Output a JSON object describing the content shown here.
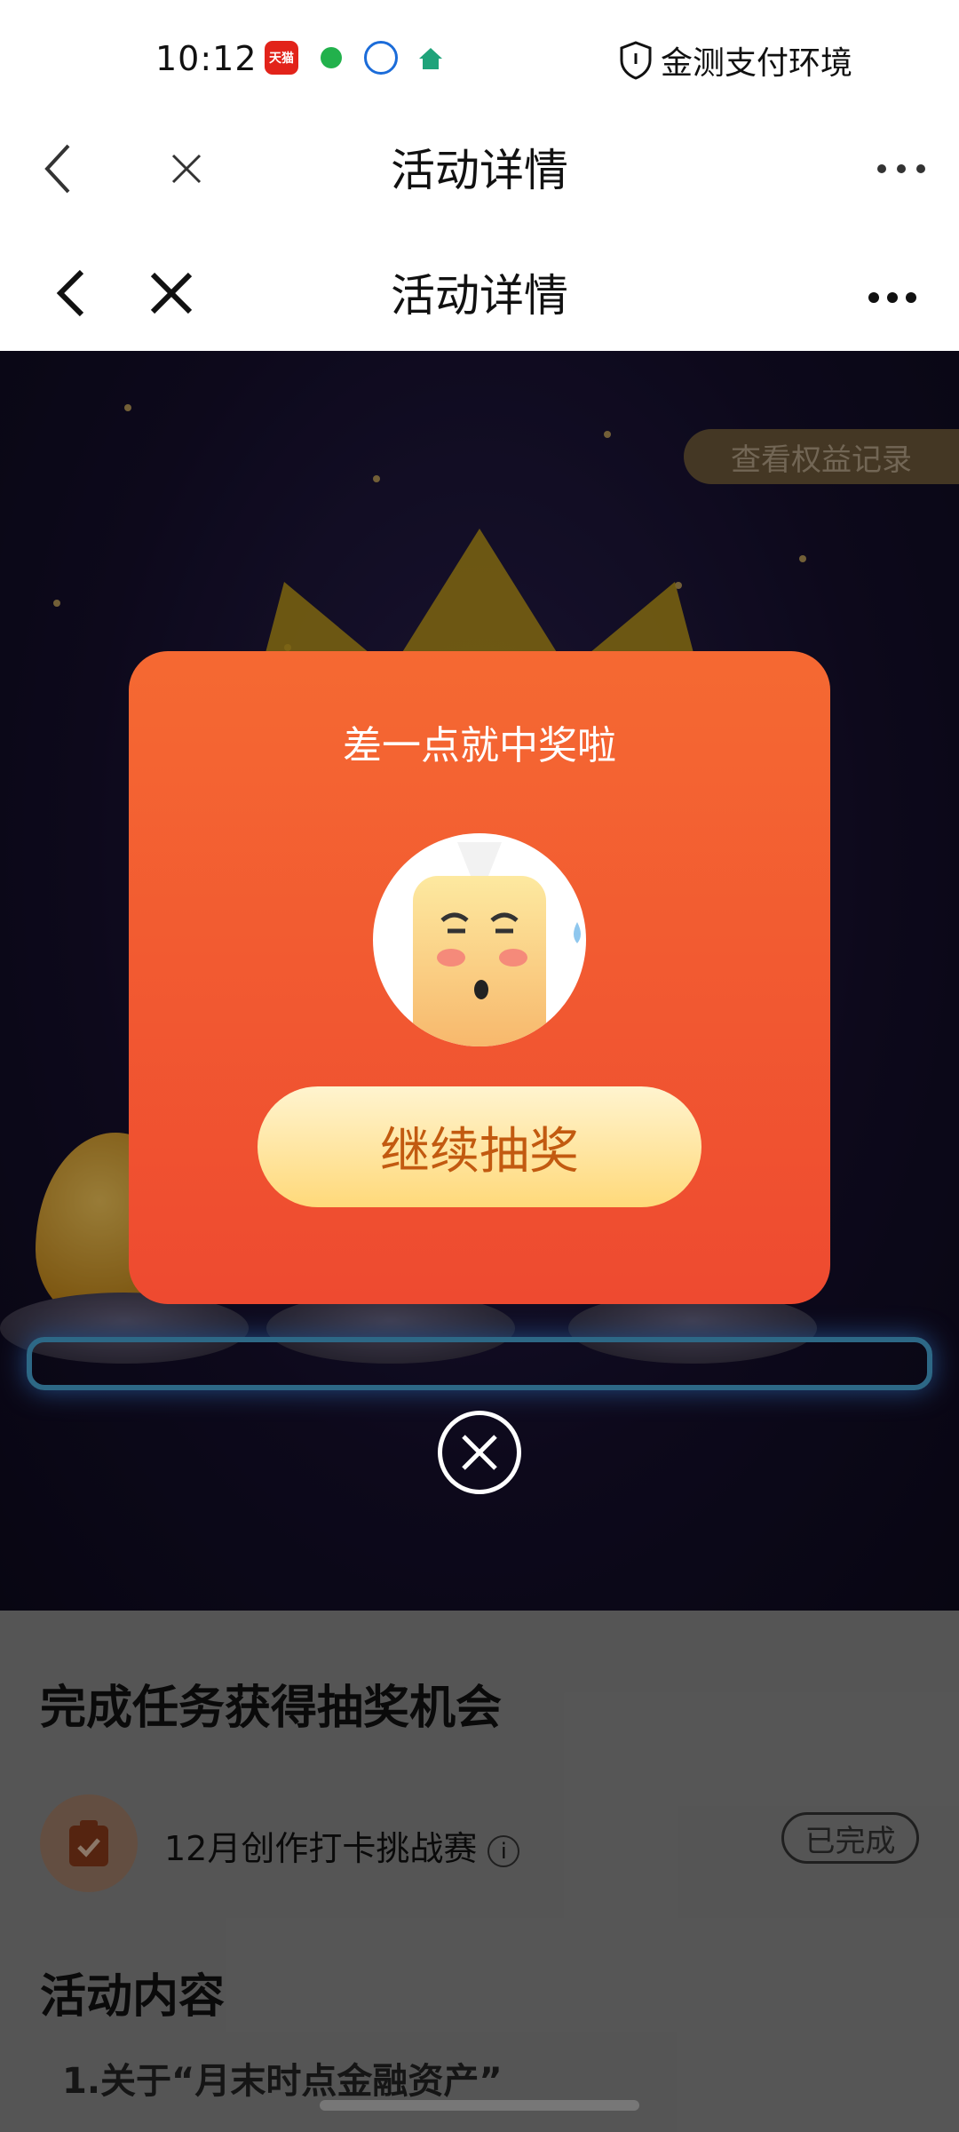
{
  "status_bar": {
    "time": "10:12",
    "app_icons": [
      "tmall-icon",
      "chat-icon",
      "blue-app-icon",
      "house-app-icon"
    ],
    "tmall_text": "天猫",
    "security_text": "金测支付环境"
  },
  "nav_outer": {
    "title": "活动详情"
  },
  "nav_inner": {
    "title": "活动详情"
  },
  "banner": {
    "rights_record": "查看权益记录"
  },
  "modal": {
    "title": "差一点就中奖啦",
    "button_label": "继续抽奖"
  },
  "tasks_section": {
    "title": "完成任务获得抽奖机会",
    "items": [
      {
        "label": "12月创作打卡挑战赛",
        "status": "已完成"
      }
    ]
  },
  "content_section": {
    "title": "活动内容",
    "first_line": "1.关于“月末时点金融资产”"
  },
  "colors": {
    "modal_top": "#f56932",
    "modal_bottom": "#ee4a30",
    "button": "#ffd97a",
    "button_text": "#c25a10"
  }
}
